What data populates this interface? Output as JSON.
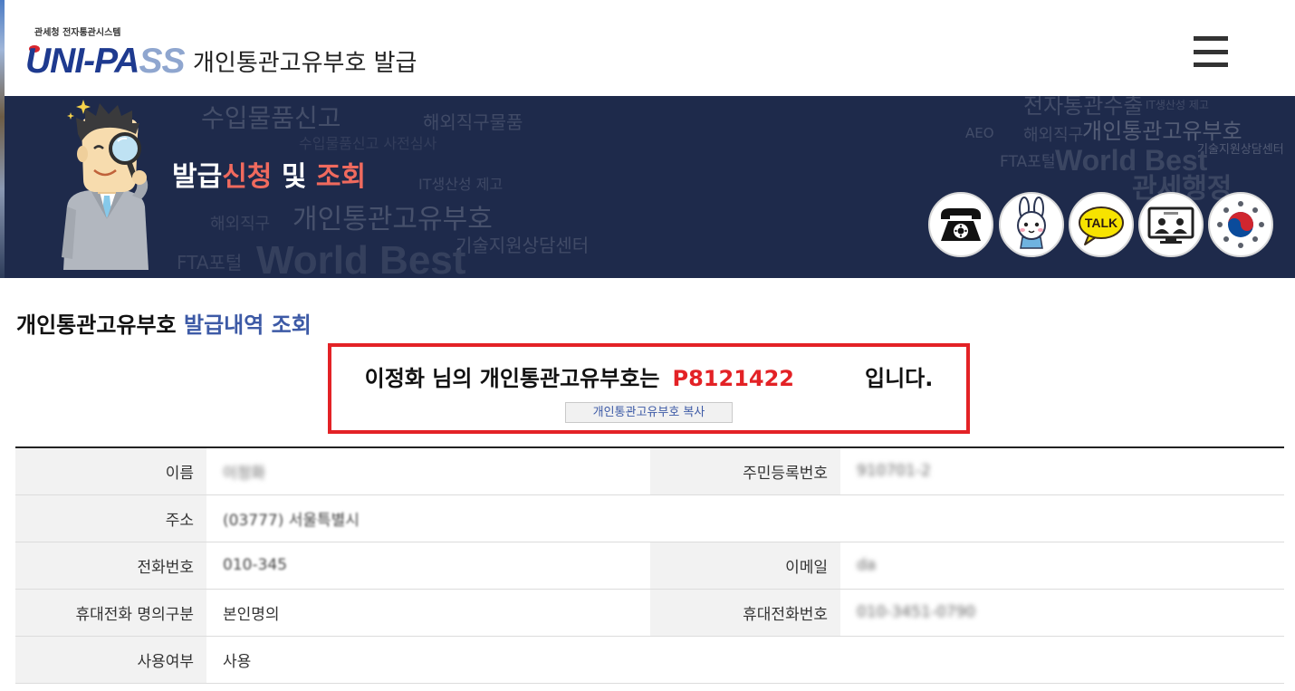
{
  "header": {
    "logo_top": "관세청 전자통관시스템",
    "logo_text_a": "UNI-PA",
    "logo_text_b": "SS",
    "title": "개인통관고유부호 발급",
    "menu_icon": "hamburger-menu-icon"
  },
  "banner": {
    "title": {
      "part1": "발급",
      "part2": "신청",
      "part3": "및",
      "part4": "조회"
    },
    "bg_words": [
      "수입물품신고",
      "해외직구물품",
      "수입물품신고 사전심사",
      "IT생산성 제고",
      "해외직구",
      "개인통관고유부호",
      "기술지원상담센터",
      "FTA포털",
      "World Best",
      "전자통관수출",
      "해외직구",
      "개인통관고유부호",
      "AEO",
      "FTA포털",
      "World Best",
      "기술지원상담센터",
      "관세행정",
      "IT생산성 제고"
    ],
    "quick_icons": [
      {
        "name": "phone-icon"
      },
      {
        "name": "mascot-icon"
      },
      {
        "name": "kakaotalk-icon",
        "label": "TALK"
      },
      {
        "name": "video-consult-icon"
      },
      {
        "name": "government-emblem-icon"
      }
    ]
  },
  "section": {
    "title_a": "개인통관고유부호",
    "title_b": "발급내역 조회"
  },
  "result": {
    "prefix": "이정화 님의 개인통관고유부호는",
    "code": "P8121422",
    "suffix": "입니다.",
    "copy_button": "개인통관고유부호 복사"
  },
  "table": {
    "rows": [
      {
        "label": "이름",
        "value": "이정화",
        "label2": "주민등록번호",
        "value2": "910701-2"
      },
      {
        "label": "주소",
        "value": "(03777) 서울특별시"
      },
      {
        "label": "전화번호",
        "value": "010-345",
        "label2": "이메일",
        "value2": "da"
      },
      {
        "label": "휴대전화 명의구분",
        "value": "본인명의",
        "label2": "휴대전화번호",
        "value2": "010-3451-0790"
      },
      {
        "label": "사용여부",
        "value": "사용"
      }
    ]
  },
  "colors": {
    "banner_bg": "#1e2a4b",
    "accent_red": "#e32226",
    "title_blue": "#3d5aa6",
    "banner_highlight": "#f06a5e"
  }
}
